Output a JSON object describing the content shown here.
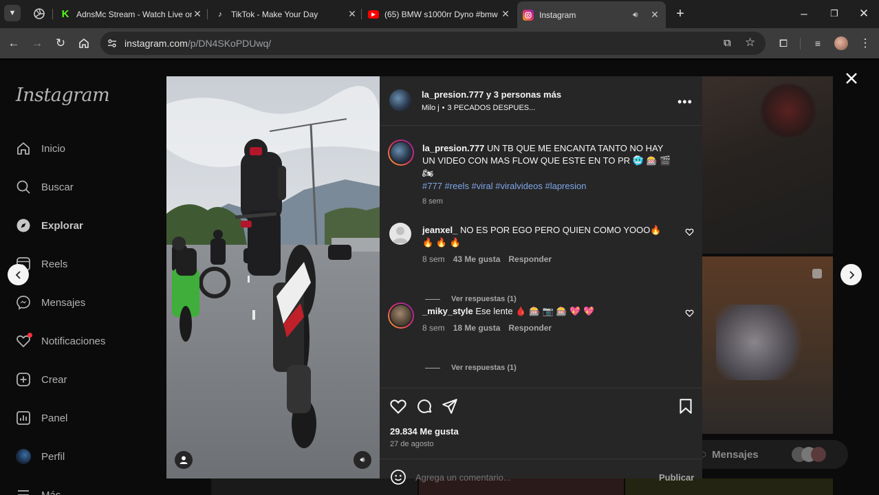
{
  "tabs": [
    {
      "title": "AdnsMc Stream - Watch Live on",
      "favicon": "kick-icon",
      "color": "#53fc18"
    },
    {
      "title": "TikTok - Make Your Day",
      "favicon": "tiktok-icon",
      "color": "#ffffff"
    },
    {
      "title": "(65) BMW s1000rr Dyno #bmw",
      "favicon": "youtube-icon",
      "color": "#ff0000"
    },
    {
      "title": "Instagram",
      "favicon": "instagram-icon",
      "color": "#e1306c",
      "active": true
    }
  ],
  "toolbar": {
    "url_host": "instagram.com",
    "url_path": "/p/DN4SKoPDUwq/"
  },
  "sidebar": {
    "logo": "Instagram",
    "items": [
      {
        "label": "Inicio",
        "icon": "home-icon"
      },
      {
        "label": "Buscar",
        "icon": "search-icon"
      },
      {
        "label": "Explorar",
        "icon": "compass-icon"
      },
      {
        "label": "Reels",
        "icon": "reels-icon"
      },
      {
        "label": "Mensajes",
        "icon": "messenger-icon"
      },
      {
        "label": "Notificaciones",
        "icon": "heart-icon"
      },
      {
        "label": "Crear",
        "icon": "plus-square-icon"
      },
      {
        "label": "Panel",
        "icon": "chart-icon"
      },
      {
        "label": "Perfil",
        "icon": "avatar"
      },
      {
        "label": "Más",
        "icon": "menu-icon"
      }
    ]
  },
  "post": {
    "header_user": "la_presion.777",
    "header_collab": "y 3 personas más",
    "audio_artist": "Milo j",
    "audio_sep": "•",
    "audio_track": "3 PECADOS DESPUES...",
    "caption_user": "la_presion.777",
    "caption_text": "UN TB QUE ME ENCANTA TANTO NO HAY UN VIDEO CON MAS FLOW QUE ESTE EN TO PR",
    "caption_emoji": "🥶 🎰 🎬 🏍",
    "hashtags": "#777 #reels #viral #viralvideos #lapresion",
    "caption_time": "8 sem",
    "likes": "29.834 Me gusta",
    "date": "27 de agosto",
    "comment_placeholder": "Agrega un comentario...",
    "publish_label": "Publicar"
  },
  "comments": [
    {
      "user": "jeanxel_",
      "text": "NO ES POR EGO PERO QUIEN COMO YOOO🔥 🔥 🔥 🔥",
      "time": "8 sem",
      "likes": "43 Me gusta",
      "reply": "Responder",
      "view_replies": "Ver respuestas (1)"
    },
    {
      "user": "_miky_style",
      "text": "Ese lente 🩸 🎰 📷 🎰 💖 💖",
      "time": "8 sem",
      "likes": "18 Me gusta",
      "reply": "Responder",
      "view_replies": "Ver respuestas (1)"
    }
  ],
  "background": {
    "messages_label": "Mensajes"
  },
  "colors": {
    "link": "#7fa7e8",
    "panel": "#262626"
  }
}
